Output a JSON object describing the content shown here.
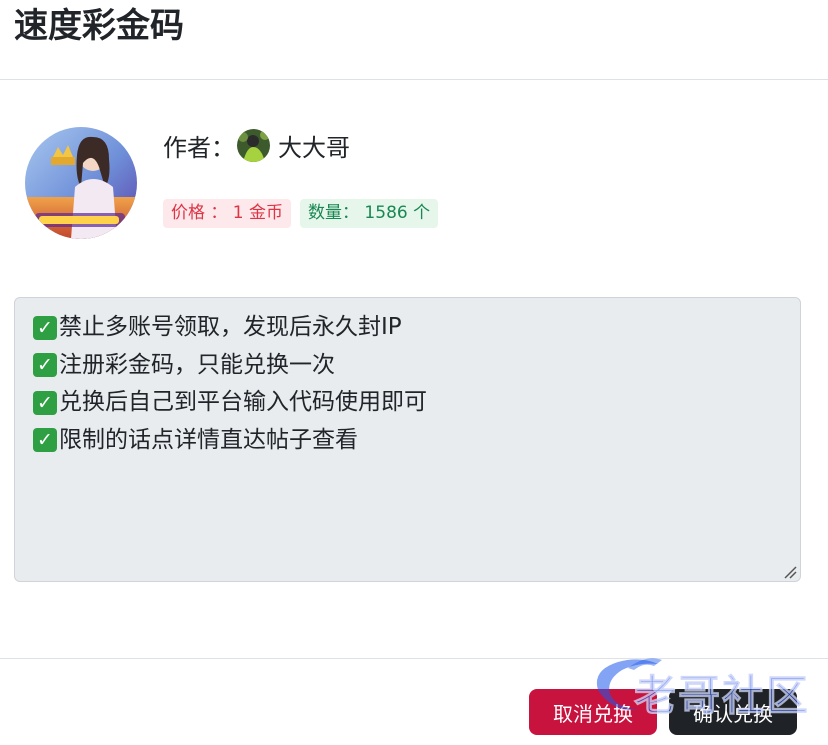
{
  "header": {
    "title": "速度彩金码"
  },
  "author": {
    "label": "作者：",
    "name": "大大哥"
  },
  "badges": {
    "price": "价格 ： 1 金币",
    "quantity": "数量：  1586 个"
  },
  "description": {
    "lines": [
      "禁止多账号领取，发现后永久封IP",
      "注册彩金码，只能兑换一次",
      "兑换后自己到平台输入代码使用即可",
      "限制的话点详情直达帖子查看"
    ]
  },
  "footer": {
    "cancel_label": "取消兑换",
    "confirm_label": "确认兑换"
  },
  "watermark": {
    "text": "老哥社区"
  },
  "colors": {
    "danger": "#c8133f",
    "dark": "#1f2328",
    "price_bg": "#fde8ec",
    "qty_bg": "#e6f6ea",
    "check": "#2ea043"
  }
}
